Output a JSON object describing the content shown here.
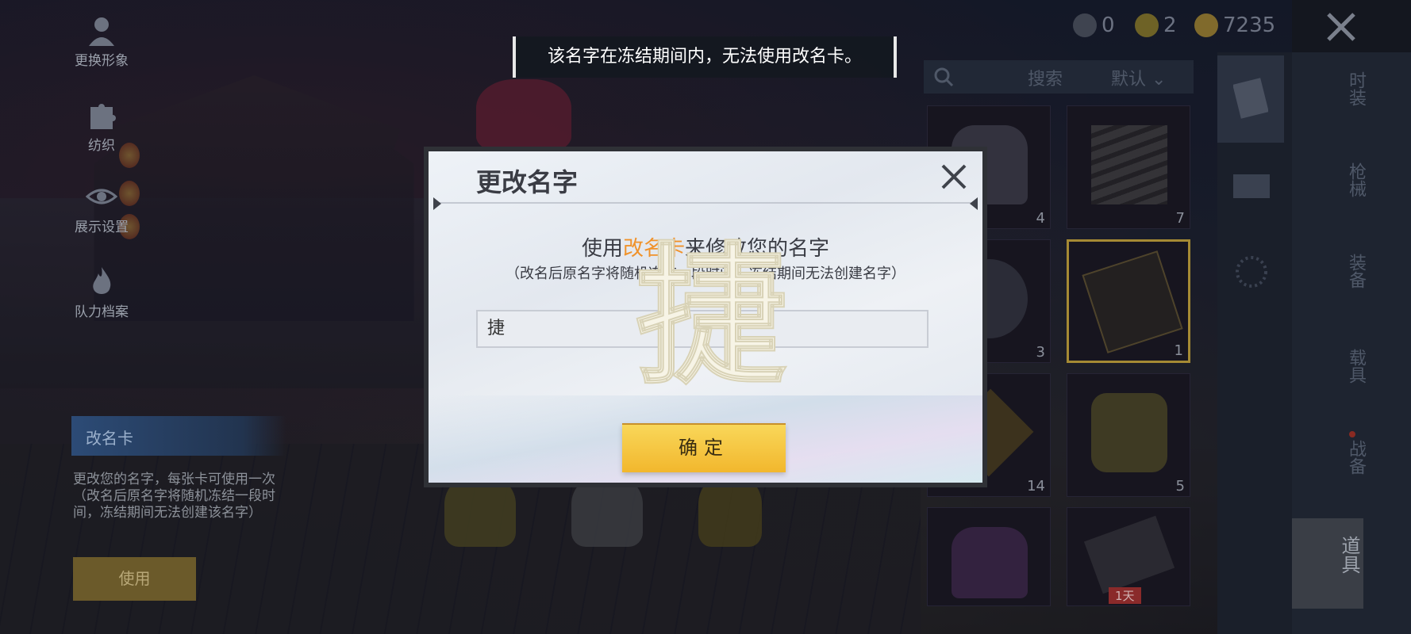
{
  "toast": {
    "message": "该名字在冻结期间内，无法使用改名卡。"
  },
  "currencies": [
    {
      "icon": "ag-coin-icon",
      "value": "0",
      "color": "#4a4f5c"
    },
    {
      "icon": "bp-coin-icon",
      "value": "2",
      "color": "#8a7a2a"
    },
    {
      "icon": "gold-coin-icon",
      "value": "7235",
      "color": "#9a7f35"
    }
  ],
  "left_menu": [
    {
      "label": "更换形象",
      "icon": "avatar-icon"
    },
    {
      "label": "纺织",
      "icon": "puzzle-icon"
    },
    {
      "label": "展示设置",
      "icon": "eye-icon"
    },
    {
      "label": "队力档案",
      "icon": "flame-icon"
    }
  ],
  "selected_item": {
    "tab_label": "改名卡",
    "description": "更改您的名字，每张卡可使用一次（改名后原名字将随机冻结一段时间，冻结期间无法创建该名字）",
    "use_label": "使用"
  },
  "inventory": {
    "search_label": "搜索",
    "sort_label": "默认",
    "items": [
      {
        "icon": "spray-can-icon",
        "count": "4"
      },
      {
        "icon": "spring-icon",
        "count": "7"
      },
      {
        "icon": "cloud-lightning-icon",
        "count": "3"
      },
      {
        "icon": "id-card-icon",
        "count": "1"
      },
      {
        "icon": "abc-sign-icon",
        "count": "14"
      },
      {
        "icon": "grenade-icon",
        "count": "5"
      },
      {
        "icon": "abc-spray-icon",
        "count": ""
      },
      {
        "icon": "double-card-icon",
        "count": ""
      }
    ],
    "item_badge": "1天"
  },
  "categories": [
    "时装",
    "枪械",
    "装备",
    "载具",
    "战备"
  ],
  "active_category": "道具",
  "modal": {
    "title": "更改名字",
    "headline_prefix": "使用",
    "headline_highlight": "改名卡",
    "headline_suffix": "来修改您的名字",
    "note": "（改名后原名字将随机冻结一段时间，冻结期间无法创建名字）",
    "input_value": "捷",
    "confirm_label": "确定",
    "overlay_char": "捷"
  },
  "colors": {
    "accent_orange": "#f0922a",
    "confirm_yellow": "#f6c842",
    "selected_border": "#a58a34"
  }
}
